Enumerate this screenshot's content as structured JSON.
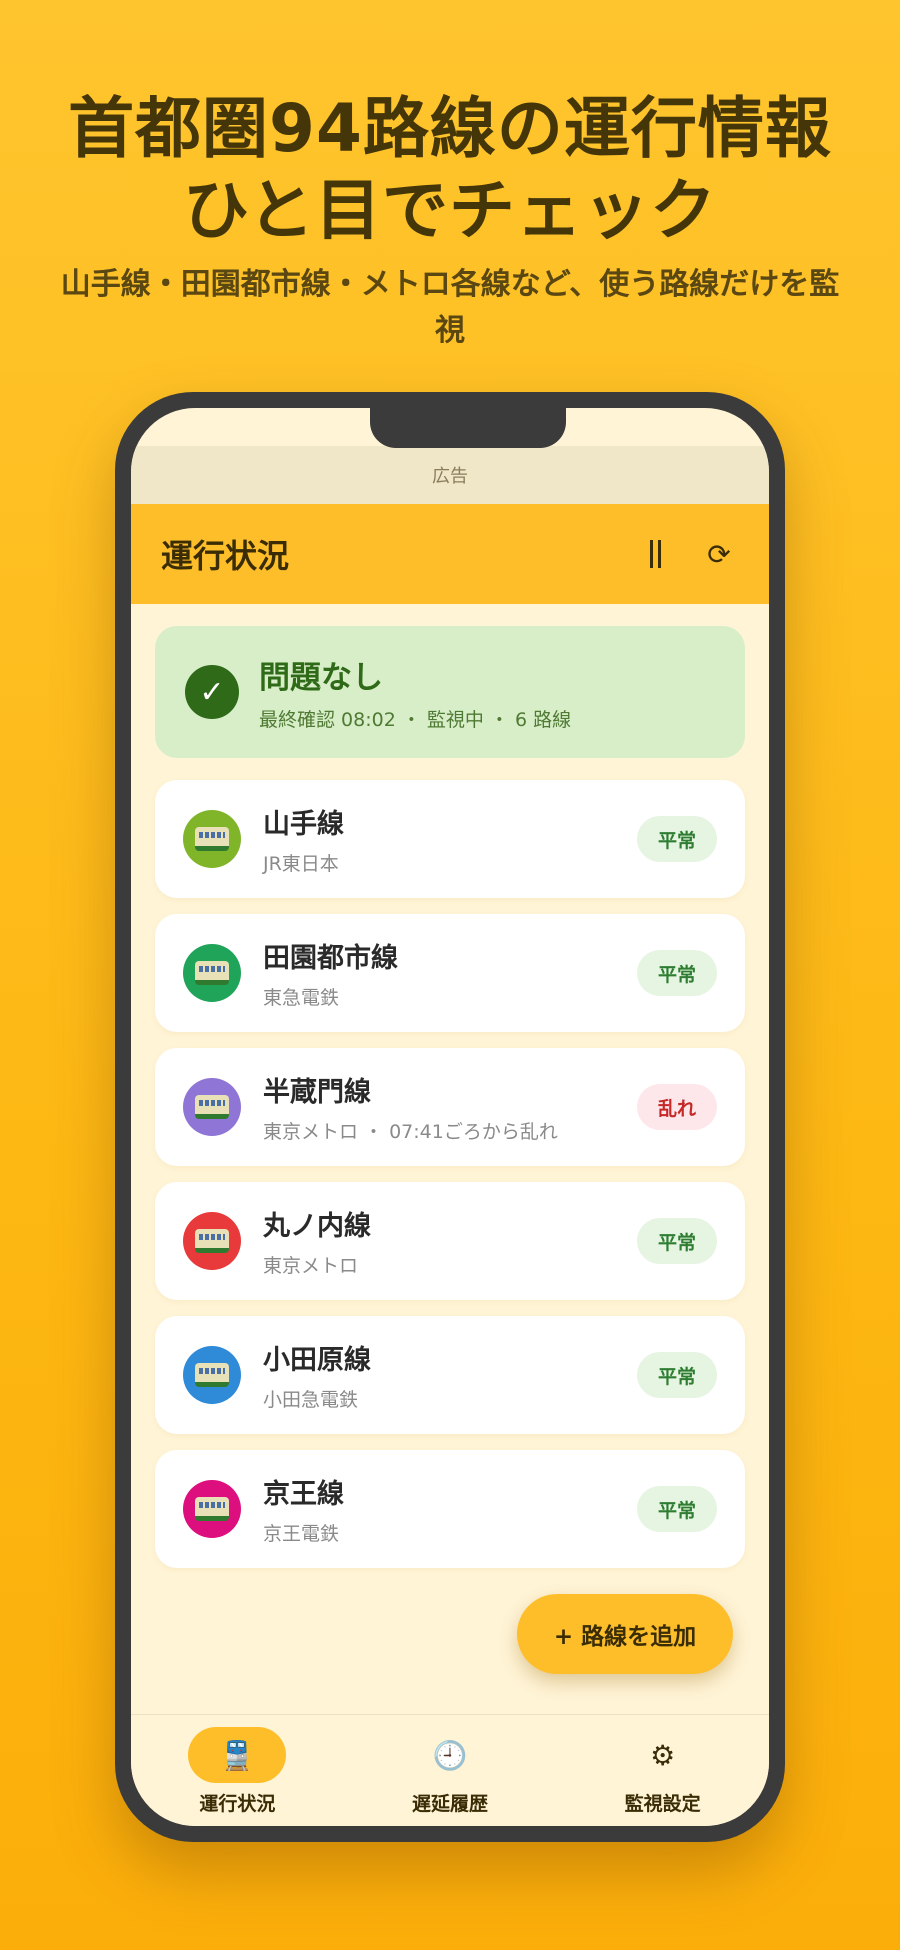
{
  "promo": {
    "headline_line1": "首都圏94路線の運行情報",
    "headline_line2": "ひと目でチェック",
    "subline": "山手線・田園都市線・メトロ各線など、使う路線だけを監視"
  },
  "ad": {
    "label": "広告"
  },
  "appbar": {
    "title": "運行状況"
  },
  "status": {
    "title": "問題なし",
    "subtitle": "最終確認 08:02 ・ 監視中 ・ 6 路線",
    "color": "#2E6A17"
  },
  "lines": [
    {
      "name": "山手線",
      "operator": "JR東日本",
      "status": "平常",
      "state": "ok",
      "color": "#80B52A"
    },
    {
      "name": "田園都市線",
      "operator": "東急電鉄",
      "status": "平常",
      "state": "ok",
      "color": "#20A45A"
    },
    {
      "name": "半蔵門線",
      "operator": "東京メトロ ・ 07:41ごろから乱れ",
      "status": "乱れ",
      "state": "bad",
      "color": "#8F76D6"
    },
    {
      "name": "丸ノ内線",
      "operator": "東京メトロ",
      "status": "平常",
      "state": "ok",
      "color": "#E83A3A"
    },
    {
      "name": "小田原線",
      "operator": "小田急電鉄",
      "status": "平常",
      "state": "ok",
      "color": "#2F8BD8"
    },
    {
      "name": "京王線",
      "operator": "京王電鉄",
      "status": "平常",
      "state": "ok",
      "color": "#DD0F7E"
    }
  ],
  "fab": {
    "label": "+ 路線を追加"
  },
  "nav": [
    {
      "label": "運行状況",
      "icon": "train-icon",
      "glyph": "🚆",
      "active": true
    },
    {
      "label": "遅延履歴",
      "icon": "clock-icon",
      "glyph": "🕘",
      "active": false
    },
    {
      "label": "監視設定",
      "icon": "gear-icon",
      "glyph": "⚙",
      "active": false
    }
  ],
  "colors": {
    "background": "#FDB813",
    "accent": "#FDBE2A",
    "screen": "#FFF4D6"
  }
}
